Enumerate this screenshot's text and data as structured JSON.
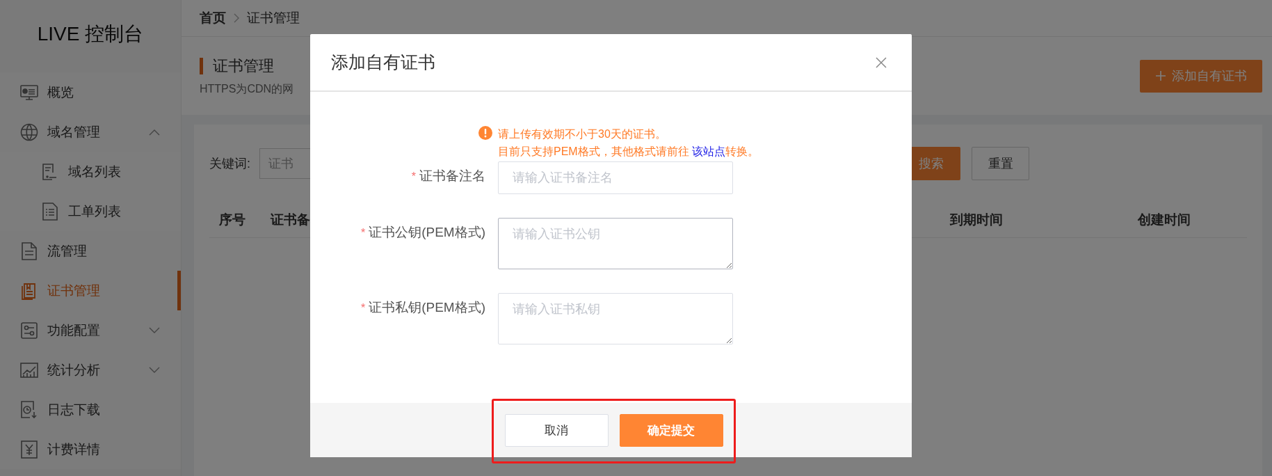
{
  "sidebar": {
    "title": "LIVE 控制台",
    "items": [
      {
        "label": "概览",
        "selected": false
      },
      {
        "label": "域名管理",
        "selected": false,
        "expanded": true,
        "children": [
          {
            "label": "域名列表",
            "selected": false
          },
          {
            "label": "工单列表",
            "selected": false
          }
        ]
      },
      {
        "label": "流管理",
        "selected": false
      },
      {
        "label": "证书管理",
        "selected": true
      },
      {
        "label": "功能配置",
        "selected": false,
        "expanded": false
      },
      {
        "label": "统计分析",
        "selected": false,
        "expanded": false
      },
      {
        "label": "日志下载",
        "selected": false
      },
      {
        "label": "计费详情",
        "selected": false
      }
    ]
  },
  "breadcrumb": [
    "首页",
    "证书管理"
  ],
  "page": {
    "title": "证书管理",
    "subtitle": "HTTPS为CDN的网",
    "add_button": "添加自有证书"
  },
  "filter": {
    "label": "关键词:",
    "placeholder": "证书",
    "search_button": "搜索",
    "reset_button": "重置"
  },
  "table": {
    "columns": [
      "序号",
      "证书备",
      "到期时间",
      "创建时间"
    ]
  },
  "dialog": {
    "title": "添加自有证书",
    "notice": {
      "line1": "请上传有效期不小于30天的证书。",
      "line2_before": "目前只支持PEM格式，其他格式请前往 ",
      "link": "该站点",
      "line2_after": "转换。"
    },
    "fields": [
      {
        "kind": "input",
        "mark": "*",
        "label": "证书备注名",
        "placeholder": "请输入证书备注名",
        "focused": false
      },
      {
        "kind": "textarea",
        "mark": "*",
        "label": "证书公钥(PEM格式)",
        "placeholder": "请输入证书公钥",
        "focused": true
      },
      {
        "kind": "textarea",
        "mark": "*",
        "label": "证书私钥(PEM格式)",
        "placeholder": "请输入证书私钥",
        "focused": false
      }
    ],
    "buttons": [
      {
        "kind": "secondary",
        "label": "取消"
      },
      {
        "kind": "primary",
        "label": "确定提交"
      }
    ]
  }
}
